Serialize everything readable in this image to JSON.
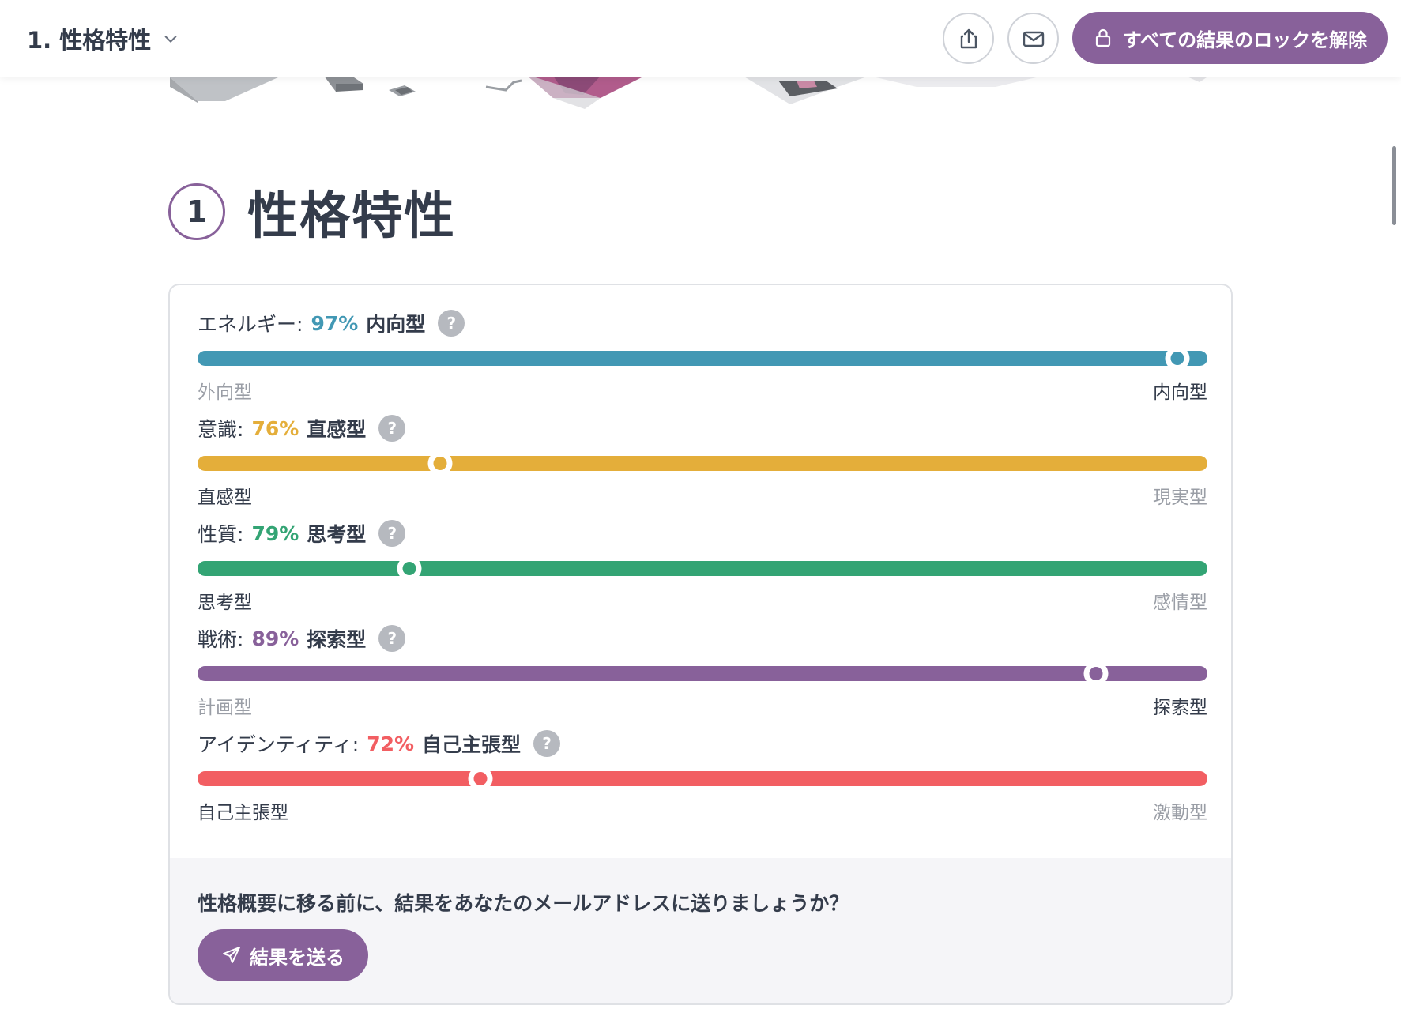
{
  "header": {
    "title": "1. 性格特性",
    "unlock_label": "すべての結果のロックを解除"
  },
  "section": {
    "number": "1",
    "title": "性格特性"
  },
  "traits": [
    {
      "label": "エネルギー:",
      "percent": "97%",
      "type": "内向型",
      "left_pole": "外向型",
      "right_pole": "内向型",
      "position": 0.97,
      "active_side": "right",
      "color": "#4298b4"
    },
    {
      "label": "意識:",
      "percent": "76%",
      "type": "直感型",
      "left_pole": "直感型",
      "right_pole": "現実型",
      "position": 0.24,
      "active_side": "left",
      "color": "#e4ae3a"
    },
    {
      "label": "性質:",
      "percent": "79%",
      "type": "思考型",
      "left_pole": "思考型",
      "right_pole": "感情型",
      "position": 0.21,
      "active_side": "left",
      "color": "#33a474"
    },
    {
      "label": "戦術:",
      "percent": "89%",
      "type": "探索型",
      "left_pole": "計画型",
      "right_pole": "探索型",
      "position": 0.89,
      "active_side": "right",
      "color": "#88619a"
    },
    {
      "label": "アイデンティティ:",
      "percent": "72%",
      "type": "自己主張型",
      "left_pole": "自己主張型",
      "right_pole": "激動型",
      "position": 0.28,
      "active_side": "left",
      "color": "#f25e62"
    }
  ],
  "cta": {
    "question": "性格概要に移る前に、結果をあなたのメールアドレスに送りましょうか？",
    "send_label": "結果を送る"
  },
  "icons": {
    "share": "share-icon",
    "email": "envelope-icon",
    "lock": "lock-icon",
    "send": "paper-plane-icon",
    "help": "question-icon",
    "dropdown": "chevron-down-icon"
  },
  "colors": {
    "accent": "#88619a"
  }
}
